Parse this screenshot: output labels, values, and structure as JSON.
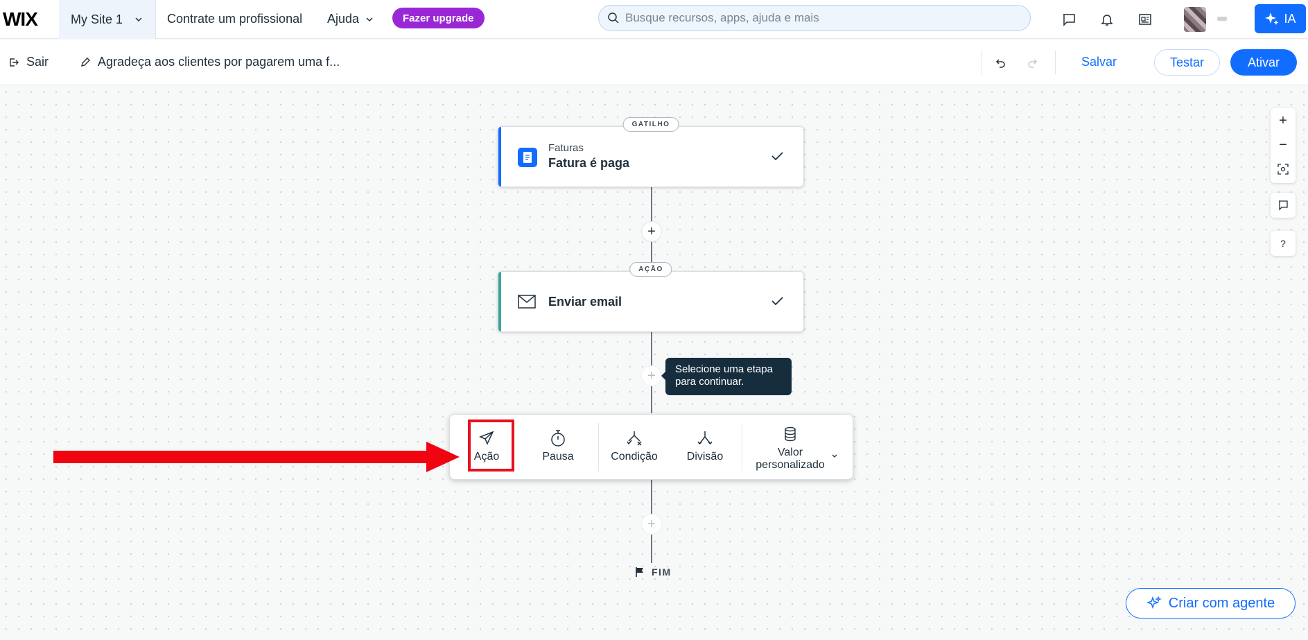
{
  "topbar": {
    "logo": "WIX",
    "site_name": "My Site 1",
    "hire_link": "Contrate um profissional",
    "help_link": "Ajuda",
    "upgrade_label": "Fazer upgrade",
    "search_placeholder": "Busque recursos, apps, ajuda e mais",
    "ia_label": "IA"
  },
  "subbar": {
    "exit_label": "Sair",
    "flow_title": "Agradeça aos clientes por pagarem uma f...",
    "save_label": "Salvar",
    "test_label": "Testar",
    "activate_label": "Ativar"
  },
  "flow": {
    "trigger": {
      "badge": "GATILHO",
      "app": "Faturas",
      "title": "Fatura é paga",
      "accent": "#116dff"
    },
    "action": {
      "badge": "AÇÃO",
      "title": "Enviar email",
      "accent": "#3aa5a0"
    },
    "tooltip": "Selecione uma etapa para continuar.",
    "picker": {
      "items": [
        {
          "label": "Ação",
          "icon": "send-icon"
        },
        {
          "label": "Pausa",
          "icon": "stopwatch-icon"
        },
        {
          "label": "Condição",
          "icon": "condition-icon"
        },
        {
          "label": "Divisão",
          "icon": "split-icon"
        },
        {
          "label": "Valor personalizado",
          "icon": "database-icon"
        }
      ]
    },
    "end_label": "FIM"
  },
  "canvas_controls": {
    "help_label": "?"
  },
  "agent_button": "Criar com agente",
  "colors": {
    "primary": "#116dff",
    "upgrade": "#9a27d5",
    "annotation": "#f00412"
  }
}
